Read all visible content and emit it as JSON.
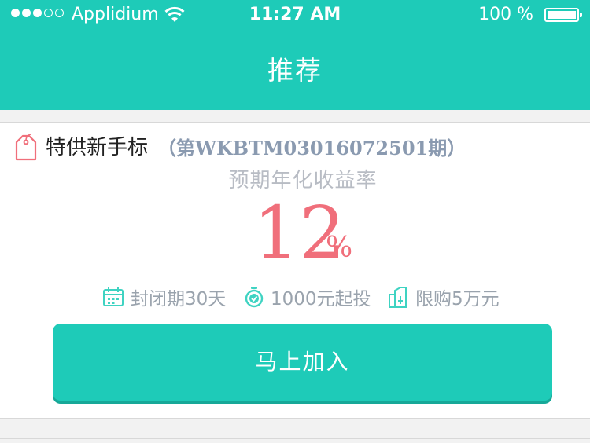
{
  "status_bar": {
    "carrier": "Applidium",
    "time": "11:27 AM",
    "battery": "100 %",
    "signal_bars_filled": 3,
    "signal_bars_total": 5
  },
  "nav": {
    "title": "推荐"
  },
  "product": {
    "name": "特供新手标",
    "period": "（第WKBTM03016072501期）",
    "rate_label": "预期年化收益率",
    "rate_value": "12",
    "rate_unit": "%",
    "features": [
      {
        "icon": "calendar-icon",
        "label": "封闭期30天"
      },
      {
        "icon": "stopwatch-icon",
        "label": "1000元起投"
      },
      {
        "icon": "purchase-limit-icon",
        "label": "限购5万元"
      }
    ],
    "join_label": "马上加入"
  },
  "colors": {
    "brand": "#1ecbb8",
    "rate": "#f06f7b",
    "muted": "#9aa3ad"
  }
}
